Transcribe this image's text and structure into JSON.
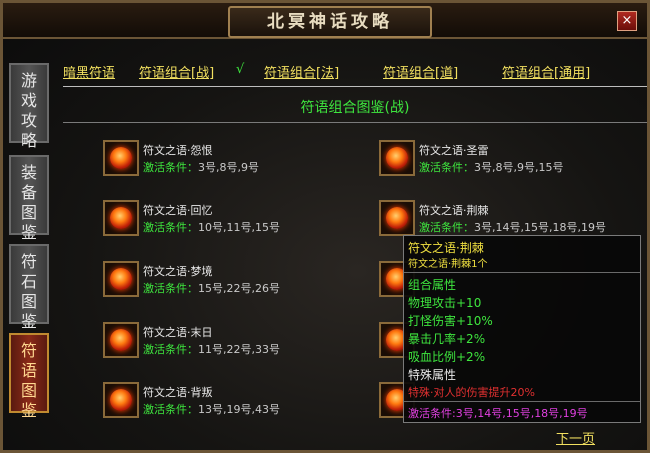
{
  "title": "北冥神话攻略",
  "close_label": "×",
  "side_tabs": [
    {
      "label": "游戏攻略",
      "chars": [
        "游",
        "戏",
        "攻",
        "略"
      ]
    },
    {
      "label": "装备图鉴",
      "chars": [
        "装",
        "备",
        "图",
        "鉴"
      ]
    },
    {
      "label": "符石图鉴",
      "chars": [
        "符",
        "石",
        "图",
        "鉴"
      ]
    },
    {
      "label": "符语图鉴",
      "chars": [
        "符",
        "语",
        "图",
        "鉴"
      ],
      "active": true
    }
  ],
  "top_tabs": [
    "暗黑符语",
    "符语组合[战]",
    "符语组合[法]",
    "符语组合[道]",
    "符语组合[通用]"
  ],
  "active_check": "√",
  "section_title": "符语组合图鉴(战)",
  "entries_left": [
    {
      "name": "符文之语·怨恨",
      "cond_key": "激活条件：",
      "cond_val": "3号,8号,9号"
    },
    {
      "name": "符文之语·回忆",
      "cond_key": "激活条件：",
      "cond_val": "10号,11号,15号"
    },
    {
      "name": "符文之语·梦境",
      "cond_key": "激活条件：",
      "cond_val": "15号,22号,26号"
    },
    {
      "name": "符文之语·末日",
      "cond_key": "激活条件：",
      "cond_val": "11号,22号,33号"
    },
    {
      "name": "符文之语·背叛",
      "cond_key": "激活条件：",
      "cond_val": "13号,19号,43号"
    }
  ],
  "entries_right": [
    {
      "name": "符文之语·圣雷",
      "cond_key": "激活条件：",
      "cond_val": "3号,8号,9号,15号"
    },
    {
      "name": "符文之语·荆棘",
      "cond_key": "激活条件：",
      "cond_val": "3号,14号,15号,18号,19号"
    }
  ],
  "tooltip": {
    "title": "符文之语·荆棘",
    "subtitle": "符文之语·荆棘1个",
    "attr_header": "组合属性",
    "attrs": [
      "物理攻击+10",
      "打怪伤害+10%",
      "暴击几率+2%",
      "吸血比例+2%"
    ],
    "special_header": "特殊属性",
    "special": "特殊·对人的伤害提升20%",
    "cond": "激活条件:3号,14号,15号,18号,19号"
  },
  "next_page": "下一页",
  "colors": {
    "accent_green": "#3ee63e",
    "tab_yellow": "#f2e060",
    "special_red": "#e03030",
    "cond_magenta": "#e040e0"
  }
}
